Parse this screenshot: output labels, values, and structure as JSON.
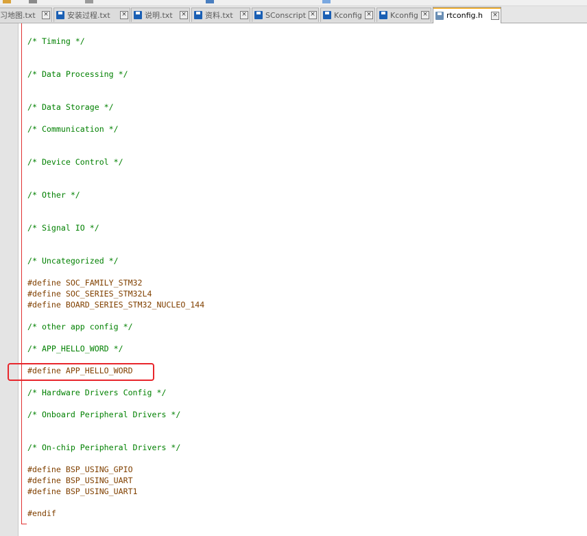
{
  "tabs": [
    {
      "label": "习地图.txt",
      "icon": "save-icon",
      "icon_color": "#1a5fb4"
    },
    {
      "label": "安装过程.txt",
      "icon": "save-icon",
      "icon_color": "#1a5fb4"
    },
    {
      "label": "说明.txt",
      "icon": "save-icon",
      "icon_color": "#1a5fb4"
    },
    {
      "label": "资料.txt",
      "icon": "save-icon",
      "icon_color": "#1a5fb4"
    },
    {
      "label": "SConscript",
      "icon": "save-icon",
      "icon_color": "#1a5fb4"
    },
    {
      "label": "Kconfig",
      "icon": "save-icon",
      "icon_color": "#1a5fb4"
    },
    {
      "label": "Kconfig",
      "icon": "save-icon",
      "icon_color": "#1a5fb4"
    },
    {
      "label": "rtconfig.h",
      "icon": "save-icon",
      "icon_color": "#6a8fb5",
      "active": true
    }
  ],
  "close_glyph": "×",
  "code": [
    {
      "text": "/* Timing */",
      "kind": "comment"
    },
    {
      "text": "/* Data Processing */",
      "kind": "comment"
    },
    {
      "text": "/* Data Storage */",
      "kind": "comment"
    },
    {
      "text": "/* Communication */",
      "kind": "comment"
    },
    {
      "text": "/* Device Control */",
      "kind": "comment"
    },
    {
      "text": "/* Other */",
      "kind": "comment"
    },
    {
      "text": "/* Signal IO */",
      "kind": "comment"
    },
    {
      "text": "/* Uncategorized */",
      "kind": "comment"
    },
    {
      "text": "#define SOC_FAMILY_STM32",
      "kind": "directive"
    },
    {
      "text": "#define SOC_SERIES_STM32L4",
      "kind": "directive"
    },
    {
      "text": "#define BOARD_SERIES_STM32_NUCLEO_144",
      "kind": "directive"
    },
    {
      "text": "/* other app config */",
      "kind": "comment"
    },
    {
      "text": "/* APP_HELLO_WORD */",
      "kind": "comment"
    },
    {
      "text": "#define APP_HELLO_WORD",
      "kind": "directive",
      "highlighted": true
    },
    {
      "text": "/* Hardware Drivers Config */",
      "kind": "comment"
    },
    {
      "text": "/* Onboard Peripheral Drivers */",
      "kind": "comment"
    },
    {
      "text": "/* On-chip Peripheral Drivers */",
      "kind": "comment"
    },
    {
      "text": "#define BSP_USING_GPIO",
      "kind": "directive"
    },
    {
      "text": "#define BSP_USING_UART",
      "kind": "directive"
    },
    {
      "text": "#define BSP_USING_UART1",
      "kind": "directive"
    },
    {
      "text": "#endif",
      "kind": "directive"
    }
  ],
  "colors": {
    "comment": "#008000",
    "directive": "#804000",
    "highlight": "#e8252b"
  }
}
